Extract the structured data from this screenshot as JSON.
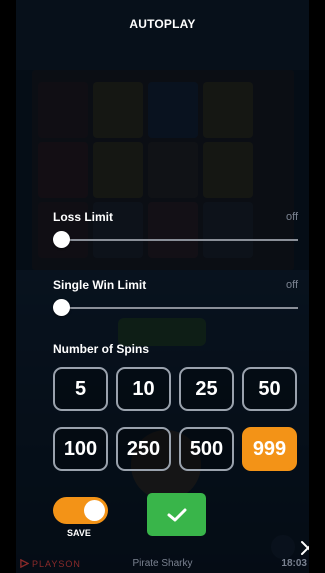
{
  "header": {
    "title": "AUTOPLAY"
  },
  "loss_limit": {
    "label": "Loss Limit",
    "value": "off",
    "level": 0
  },
  "single_win_limit": {
    "label": "Single Win Limit",
    "value": "off",
    "level": 0
  },
  "spins": {
    "label": "Number of Spins",
    "options": [
      "5",
      "10",
      "25",
      "50",
      "100",
      "250",
      "500",
      "999"
    ],
    "selected": "999"
  },
  "save": {
    "label": "SAVE",
    "on": true
  },
  "colors": {
    "accent": "#f39317",
    "confirm": "#39b54a"
  },
  "icons": {
    "confirm": "check-icon",
    "close": "close-icon",
    "brand": "playson-logo-icon"
  },
  "footer": {
    "brand": "PLAYSON",
    "game": "Pirate Sharky",
    "time": "18:03"
  }
}
